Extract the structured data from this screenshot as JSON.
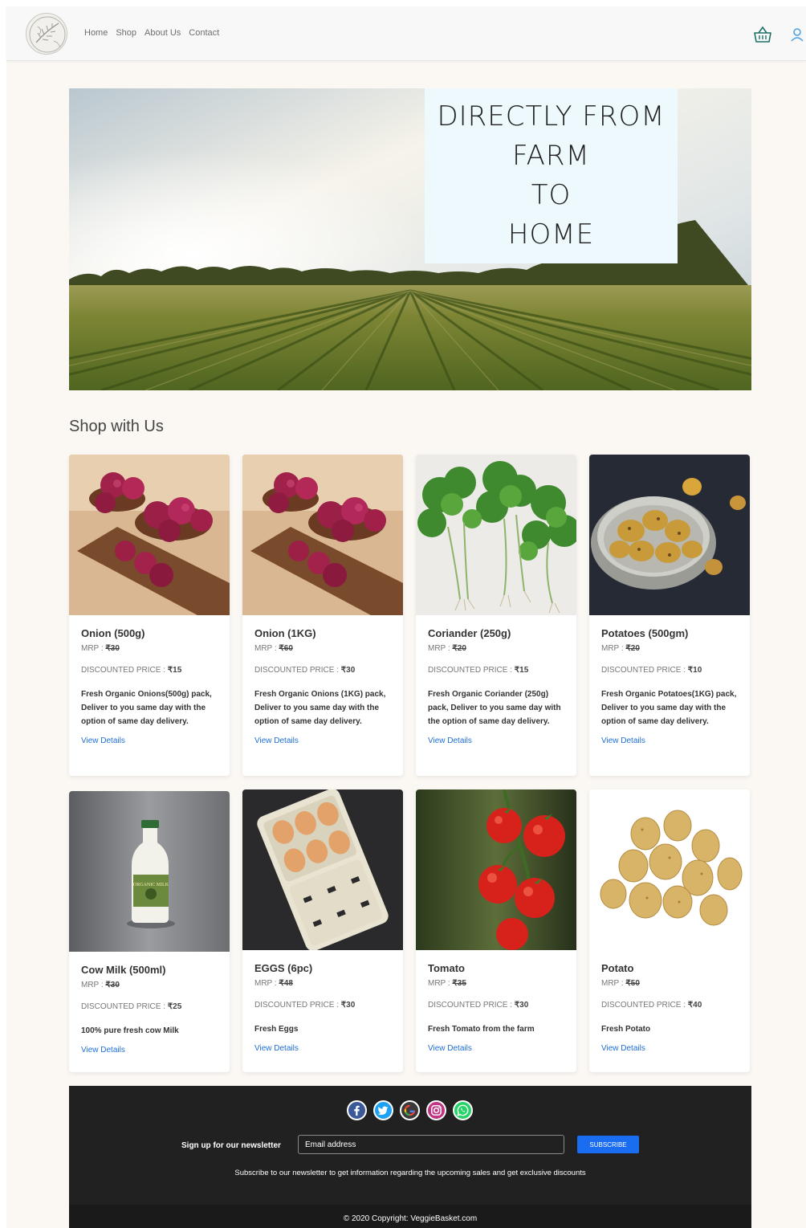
{
  "nav": {
    "links": [
      "Home",
      "Shop",
      "About Us",
      "Contact"
    ]
  },
  "hero": {
    "lines": [
      "DIRECTLY FROM",
      "FARM",
      "TO",
      "HOME"
    ]
  },
  "section": {
    "title": "Shop with Us"
  },
  "labels": {
    "mrp": "MRP : ",
    "discount": "DISCOUNTED PRICE : ",
    "view": "View Details"
  },
  "products": [
    {
      "name": "Onion (500g)",
      "mrp": "₹30",
      "price": "₹15",
      "desc": "Fresh Organic Onions(500g) pack, Deliver to you same day with the option of same day delivery.",
      "image": "red-onions"
    },
    {
      "name": "Onion (1KG)",
      "mrp": "₹60",
      "price": "₹30",
      "desc": "Fresh Organic Onions (1KG) pack, Deliver to you same day with the option of same day delivery.",
      "image": "red-onions"
    },
    {
      "name": "Coriander (250g)",
      "mrp": "₹20",
      "price": "₹15",
      "desc": "Fresh Organic Coriander (250g) pack, Deliver to you same day with the option of same day delivery.",
      "image": "coriander"
    },
    {
      "name": "Potatoes (500gm)",
      "mrp": "₹20",
      "price": "₹10",
      "desc": "Fresh Organic Potatoes(1KG) pack, Deliver to you same day with the option of same day delivery.",
      "image": "potatoes-bowl"
    },
    {
      "name": "Cow Milk (500ml)",
      "mrp": "₹30",
      "price": "₹25",
      "desc": "100% pure fresh cow Milk",
      "image": "milk-bottle",
      "bottle_label": "ORGANIC MILK"
    },
    {
      "name": "EGGS (6pc)",
      "mrp": "₹48",
      "price": "₹30",
      "desc": "Fresh Eggs",
      "image": "egg-carton"
    },
    {
      "name": "Tomato",
      "mrp": "₹35",
      "price": "₹30",
      "desc": "Fresh Tomato from the farm",
      "image": "tomatoes"
    },
    {
      "name": "Potato",
      "mrp": "₹50",
      "price": "₹40",
      "desc": "Fresh Potato",
      "image": "potatoes-pile"
    }
  ],
  "footer": {
    "social": [
      "facebook-icon",
      "twitter-icon",
      "google-icon",
      "instagram-icon",
      "whatsapp-icon"
    ],
    "newsletter_label": "Sign up for our newsletter",
    "email_placeholder": "Email address",
    "subscribe": "SUBSCRIBE",
    "note": "Subscribe to our newsletter to get information regarding the upcoming sales and get exclusive discounts",
    "copyright": "© 2020 Copyright: VeggieBasket.com"
  },
  "colors": {
    "accent": "#1a6cf0",
    "link": "#1f6fd6",
    "footer": "#212121",
    "page": "#fbf8f4"
  }
}
